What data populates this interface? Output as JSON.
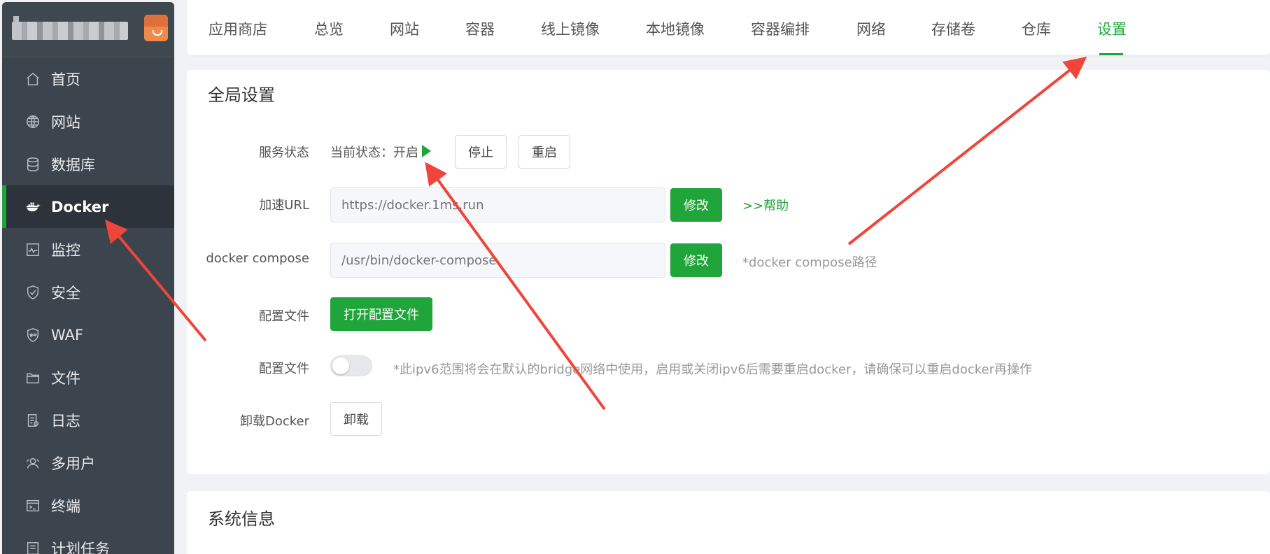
{
  "sidebar": {
    "items": [
      {
        "label": "首页",
        "icon": "home-icon"
      },
      {
        "label": "网站",
        "icon": "globe-icon"
      },
      {
        "label": "数据库",
        "icon": "database-icon"
      },
      {
        "label": "Docker",
        "icon": "docker-icon",
        "active": true
      },
      {
        "label": "监控",
        "icon": "monitor-icon"
      },
      {
        "label": "安全",
        "icon": "shield-icon"
      },
      {
        "label": "WAF",
        "icon": "waf-icon"
      },
      {
        "label": "文件",
        "icon": "folder-icon"
      },
      {
        "label": "日志",
        "icon": "log-icon"
      },
      {
        "label": "多用户",
        "icon": "users-icon"
      },
      {
        "label": "终端",
        "icon": "terminal-icon"
      },
      {
        "label": "计划任务",
        "icon": "clock-icon"
      }
    ]
  },
  "tabs": [
    "应用商店",
    "总览",
    "网站",
    "容器",
    "线上镜像",
    "本地镜像",
    "容器编排",
    "网络",
    "存储卷",
    "仓库",
    "设置"
  ],
  "active_tab": "设置",
  "global_settings": {
    "title": "全局设置",
    "service_status": {
      "label": "服务状态",
      "current": "当前状态：开启",
      "stop_button": "停止",
      "restart_button": "重启"
    },
    "mirror_url": {
      "label": "加速URL",
      "placeholder": "https://docker.1ms.run",
      "modify_button": "修改",
      "help_link": ">>帮助"
    },
    "docker_compose": {
      "label": "docker compose",
      "placeholder": "/usr/bin/docker-compose",
      "modify_button": "修改",
      "hint": "*docker compose路径"
    },
    "config_file": {
      "label": "配置文件",
      "button": "打开配置文件"
    },
    "ipv6": {
      "label": "配置文件",
      "enabled": false,
      "hint": "*此ipv6范围将会在默认的bridge网络中使用，启用或关闭ipv6后需要重启docker，请确保可以重启docker再操作"
    },
    "uninstall": {
      "label": "卸载Docker",
      "button": "卸载"
    }
  },
  "system_info": {
    "title": "系统信息"
  },
  "colors": {
    "accent": "#20a53a",
    "sidebar_bg": "#3c444d",
    "annotation_arrow": "#f0453a"
  }
}
